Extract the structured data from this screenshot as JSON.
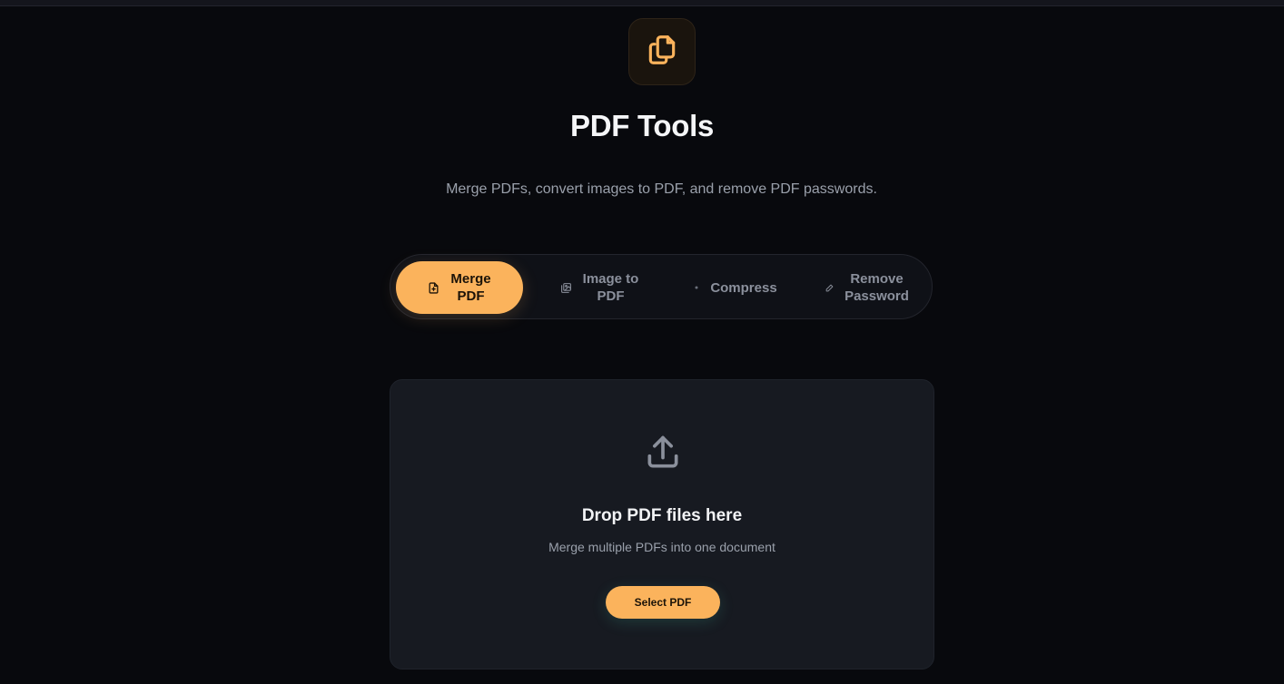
{
  "app": {
    "title": "PDF Tools",
    "subtitle": "Merge PDFs, convert images to PDF, and remove PDF passwords.",
    "logo_icon": "copy-icon",
    "accent_color": "#fbb35c"
  },
  "tabs": [
    {
      "label": "Merge\nPDF",
      "icon": "file-plus-icon",
      "active": true
    },
    {
      "label": "Image to\nPDF",
      "icon": "images-icon",
      "active": false
    },
    {
      "label": "Compress",
      "icon": "dot-icon",
      "active": false
    },
    {
      "label": "Remove\nPassword",
      "icon": "pencil-icon",
      "active": false
    }
  ],
  "dropzone": {
    "icon": "upload-icon",
    "title": "Drop PDF files here",
    "subtitle": "Merge multiple PDFs into one document",
    "button_label": "Select PDF"
  }
}
